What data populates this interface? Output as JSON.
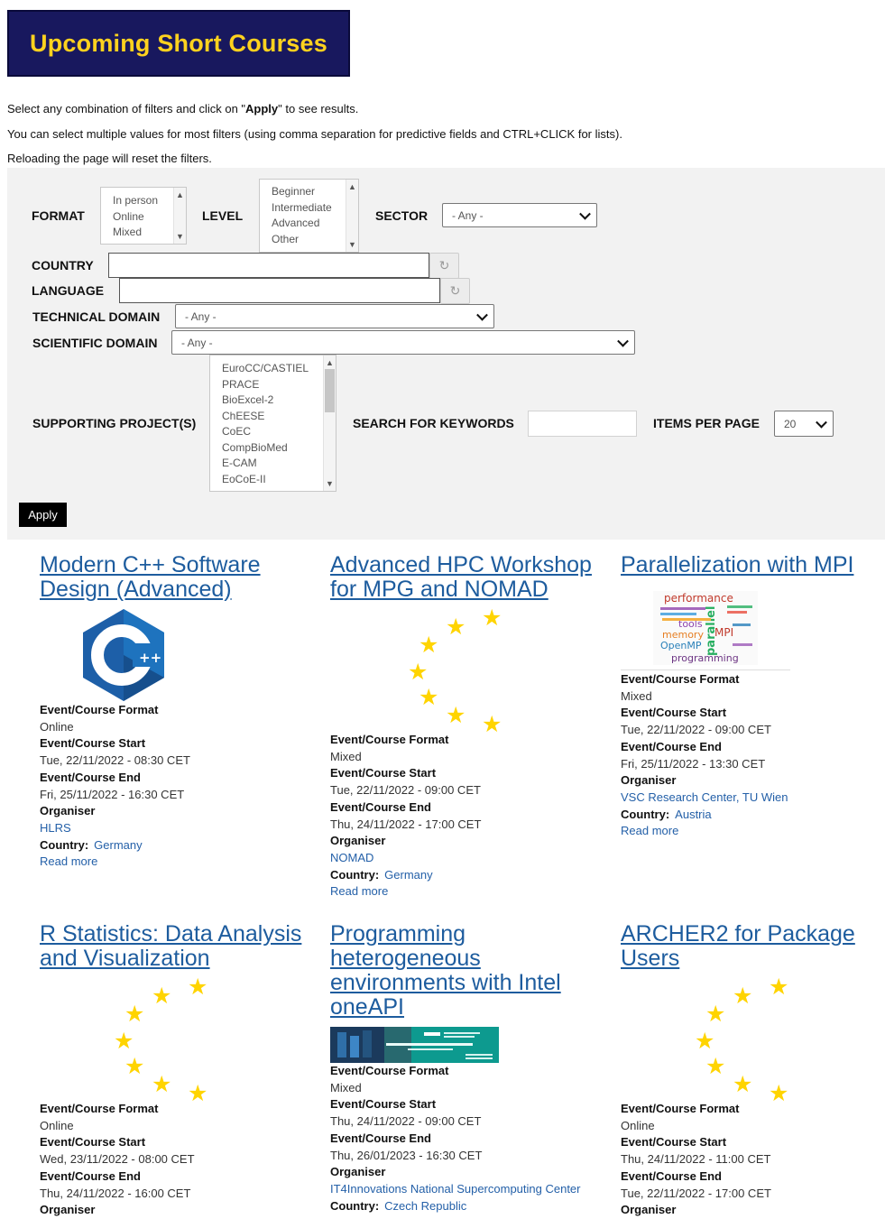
{
  "page_title": "Upcoming Short Courses",
  "intro": {
    "line1_pre": "Select any combination of filters and click on \"",
    "line1_bold": "Apply",
    "line1_post": "\" to see results.",
    "line2": "You can select multiple values for most filters (using comma separation for predictive fields and CTRL+CLICK for lists).",
    "line3": "Reloading the page will reset the filters."
  },
  "filters": {
    "format": {
      "label": "FORMAT",
      "options": [
        "In person",
        "Online",
        "Mixed"
      ]
    },
    "level": {
      "label": "LEVEL",
      "options": [
        "Beginner",
        "Intermediate",
        "Advanced",
        "Other"
      ]
    },
    "sector": {
      "label": "SECTOR",
      "value": "- Any -"
    },
    "country": {
      "label": "COUNTRY",
      "value": ""
    },
    "language": {
      "label": "LANGUAGE",
      "value": ""
    },
    "technical_domain": {
      "label": "TECHNICAL DOMAIN",
      "value": "- Any -"
    },
    "scientific_domain": {
      "label": "SCIENTIFIC DOMAIN",
      "value": "- Any -"
    },
    "supporting_projects": {
      "label": "SUPPORTING PROJECT(S)",
      "options": [
        "EuroCC/CASTIEL",
        "PRACE",
        "BioExcel-2",
        "ChEESE",
        "CoEC",
        "CompBioMed",
        "E-CAM",
        "EoCoE-II"
      ]
    },
    "keywords": {
      "label": "SEARCH FOR KEYWORDS",
      "value": ""
    },
    "items_per_page": {
      "label": "ITEMS PER PAGE",
      "value": "20"
    },
    "apply_label": "Apply"
  },
  "field_labels": {
    "format": "Event/Course Format",
    "start": "Event/Course Start",
    "end": "Event/Course End",
    "organiser": "Organiser",
    "country": "Country:",
    "read_more": "Read more"
  },
  "colors": {
    "banner_bg": "#18185e",
    "banner_text": "#ffd21e",
    "link": "#2460a8",
    "title": "#1d5c9e",
    "star": "#ffd400"
  },
  "courses": [
    {
      "title": "Modern C++ Software Design (Advanced)",
      "image": "cpp-logo",
      "format": "Online",
      "start": "Tue, 22/11/2022 - 08:30 CET",
      "end": "Fri, 25/11/2022 - 16:30 CET",
      "organiser": "HLRS",
      "country": "Germany"
    },
    {
      "title": "Advanced HPC Workshop for MPG and NOMAD",
      "image": "eu-stars",
      "format": "Mixed",
      "start": "Tue, 22/11/2022 - 09:00 CET",
      "end": "Thu, 24/11/2022 - 17:00 CET",
      "organiser": "NOMAD",
      "country": "Germany"
    },
    {
      "title": "Parallelization with MPI",
      "image": "word-cloud",
      "cloud_words": [
        "performance",
        "tools",
        "memory",
        "MPI",
        "OpenMP",
        "parallel",
        "programming"
      ],
      "format": "Mixed",
      "start": "Tue, 22/11/2022 - 09:00 CET",
      "end": "Fri, 25/11/2022 - 13:30 CET",
      "organiser": "VSC Research Center, TU Wien",
      "country": "Austria"
    },
    {
      "title": "R Statistics: Data Analysis and Visualization",
      "image": "eu-stars",
      "format": "Online",
      "start": "Wed, 23/11/2022 - 08:00 CET",
      "end": "Thu, 24/11/2022 - 16:00 CET",
      "organiser": ""
    },
    {
      "title": "Programming heterogeneous environments with Intel oneAPI",
      "image": "intel-banner",
      "format": "Mixed",
      "start": "Thu, 24/11/2022 - 09:00 CET",
      "end": "Thu, 26/01/2023 - 16:30 CET",
      "organiser": "IT4Innovations National Supercomputing Center",
      "country": "Czech Republic"
    },
    {
      "title": "ARCHER2 for Package Users",
      "image": "eu-stars",
      "format": "Online",
      "start": "Thu, 24/11/2022 - 11:00 CET",
      "end": "Tue, 22/11/2022 - 17:00 CET",
      "organiser": ""
    }
  ]
}
